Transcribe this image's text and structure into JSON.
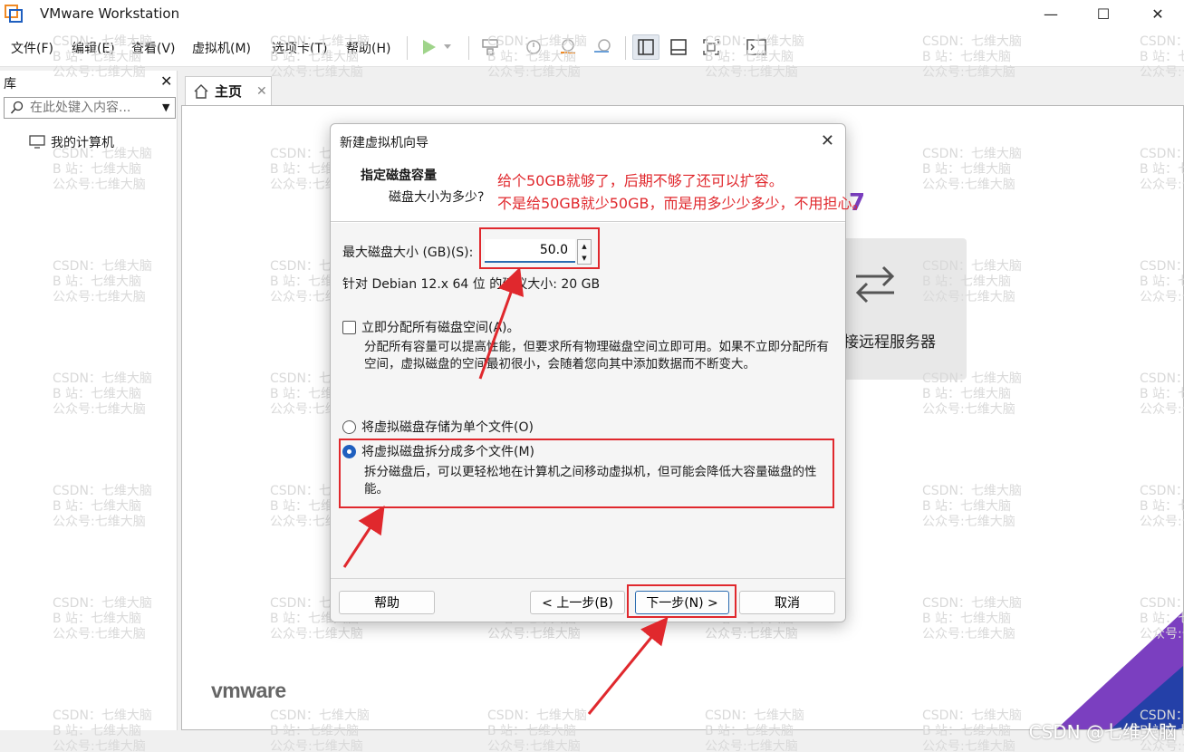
{
  "window": {
    "title": "VMware Workstation",
    "minimize": "—",
    "maximize": "☐",
    "close": "✕"
  },
  "menu": [
    {
      "label": "文件(F)"
    },
    {
      "label": "编辑(E)"
    },
    {
      "label": "查看(V)"
    },
    {
      "label": "虚拟机(M)"
    },
    {
      "label": "选项卡(T)"
    },
    {
      "label": "帮助(H)"
    }
  ],
  "library": {
    "title": "库",
    "close": "✕",
    "search_placeholder": "在此处键入内容...",
    "tree_item": "我的计算机"
  },
  "tabs": {
    "home_label": "主页",
    "home_close": "✕"
  },
  "home": {
    "remote_server_label": "接远程服务器",
    "logo_text": "vmware"
  },
  "dialog": {
    "title": "新建虚拟机向导",
    "close": "✕",
    "heading": "指定磁盘容量",
    "subheading": "磁盘大小为多少?",
    "size_label": "最大磁盘大小 (GB)(S):",
    "size_value": "50.0",
    "recommend": "针对 Debian 12.x 64 位 的建议大小: 20 GB",
    "allocate_label": "立即分配所有磁盘空间(A)。",
    "allocate_checked": false,
    "allocate_desc": "分配所有容量可以提高性能，但要求所有物理磁盘空间立即可用。如果不立即分配所有空间，虚拟磁盘的空间最初很小，会随着您向其中添加数据而不断变大。",
    "single_file_label": "将虚拟磁盘存储为单个文件(O)",
    "single_file_selected": false,
    "split_label": "将虚拟磁盘拆分成多个文件(M)",
    "split_selected": true,
    "split_desc": "拆分磁盘后，可以更轻松地在计算机之间移动虚拟机，但可能会降低大容量磁盘的性能。",
    "help_button": "帮助",
    "back_button": "< 上一步(B)",
    "next_button": "下一步(N) >",
    "cancel_button": "取消"
  },
  "annotation": {
    "line1": "给个50GB就够了，后期不够了还可以扩容。",
    "line2": "不是给50GB就少50GB，而是用多少少多少，不用担心。",
    "color": "#e0282d"
  },
  "watermark": {
    "line1": "CSDN：七维大脑",
    "line2": "B 站：七维大脑",
    "line3": "公众号:七维大脑",
    "footer": "CSDN @七维大脑"
  },
  "colors": {
    "accent_blue": "#1f5fbf",
    "play_green": "#6cc04a",
    "brand_purple": "#7b3fc0"
  }
}
